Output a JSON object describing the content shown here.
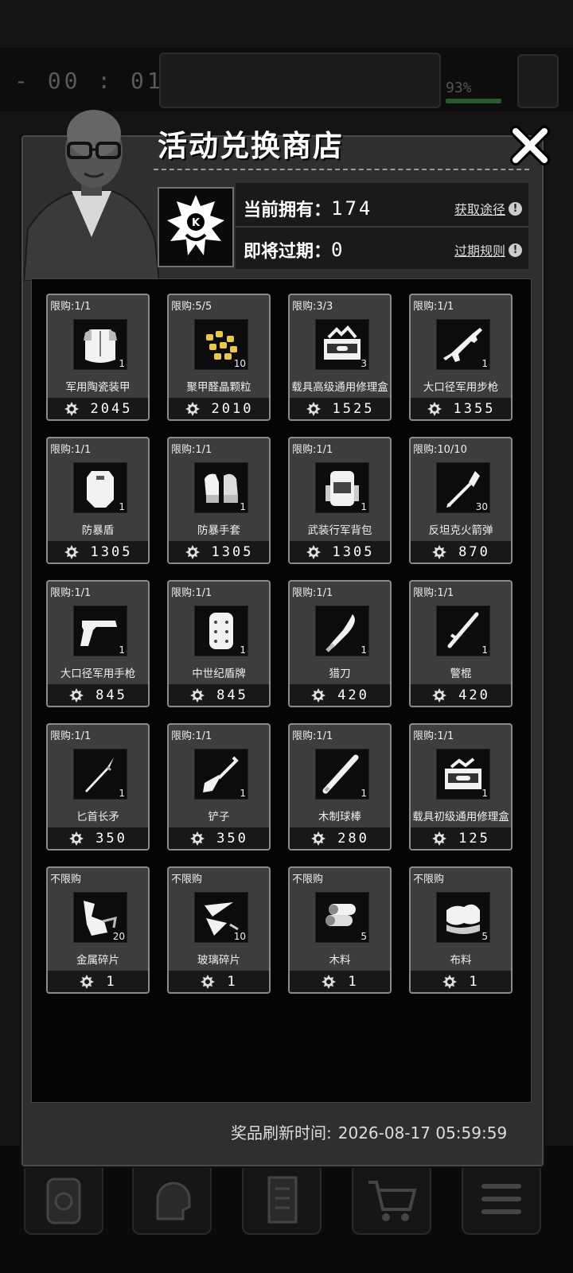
{
  "background": {
    "timer": "- 00 : 01 -",
    "battery": "93%"
  },
  "shop": {
    "title": "活动兑换商店",
    "owned_label": "当前拥有：",
    "owned_value": "174",
    "expiring_label": "即将过期：",
    "expiring_value": "0",
    "obtain_link": "获取途径",
    "expire_rule_link": "过期规则",
    "refresh_label": "奖品刷新时间:",
    "refresh_time": "2026-08-17 05:59:59"
  },
  "items": [
    {
      "limit": "限购:1/1",
      "name": "军用陶瓷装甲",
      "qty": "1",
      "price": "2045",
      "icon": "armor-vest-icon"
    },
    {
      "limit": "限购:5/5",
      "name": "聚甲醛晶颗粒",
      "qty": "10",
      "price": "2010",
      "icon": "granules-icon"
    },
    {
      "limit": "限购:3/3",
      "name": "载具高级通用修理盒",
      "qty": "3",
      "price": "1525",
      "icon": "repair-box-advanced-icon"
    },
    {
      "limit": "限购:1/1",
      "name": "大口径军用步枪",
      "qty": "1",
      "price": "1355",
      "icon": "rifle-icon"
    },
    {
      "limit": "限购:1/1",
      "name": "防暴盾",
      "qty": "1",
      "price": "1305",
      "icon": "riot-shield-icon"
    },
    {
      "limit": "限购:1/1",
      "name": "防暴手套",
      "qty": "1",
      "price": "1305",
      "icon": "riot-gloves-icon"
    },
    {
      "limit": "限购:1/1",
      "name": "武装行军背包",
      "qty": "1",
      "price": "1305",
      "icon": "backpack-icon"
    },
    {
      "limit": "限购:10/10",
      "name": "反坦克火箭弹",
      "qty": "30",
      "price": "870",
      "icon": "rocket-icon"
    },
    {
      "limit": "限购:1/1",
      "name": "大口径军用手枪",
      "qty": "1",
      "price": "845",
      "icon": "pistol-icon"
    },
    {
      "limit": "限购:1/1",
      "name": "中世纪盾牌",
      "qty": "1",
      "price": "845",
      "icon": "medieval-shield-icon"
    },
    {
      "limit": "限购:1/1",
      "name": "猎刀",
      "qty": "1",
      "price": "420",
      "icon": "machete-icon"
    },
    {
      "limit": "限购:1/1",
      "name": "警棍",
      "qty": "1",
      "price": "420",
      "icon": "baton-icon"
    },
    {
      "limit": "限购:1/1",
      "name": "匕首长矛",
      "qty": "1",
      "price": "350",
      "icon": "dagger-spear-icon"
    },
    {
      "limit": "限购:1/1",
      "name": "铲子",
      "qty": "1",
      "price": "350",
      "icon": "shovel-icon"
    },
    {
      "limit": "限购:1/1",
      "name": "木制球棒",
      "qty": "1",
      "price": "280",
      "icon": "baseball-bat-icon"
    },
    {
      "limit": "限购:1/1",
      "name": "载具初级通用修理盒",
      "qty": "1",
      "price": "125",
      "icon": "repair-box-basic-icon"
    },
    {
      "limit": "不限购",
      "name": "金属碎片",
      "qty": "20",
      "price": "1",
      "icon": "metal-scrap-icon"
    },
    {
      "limit": "不限购",
      "name": "玻璃碎片",
      "qty": "10",
      "price": "1",
      "icon": "glass-shard-icon"
    },
    {
      "limit": "不限购",
      "name": "木料",
      "qty": "5",
      "price": "1",
      "icon": "wood-logs-icon"
    },
    {
      "limit": "不限购",
      "name": "布料",
      "qty": "5",
      "price": "1",
      "icon": "cloth-icon"
    }
  ]
}
